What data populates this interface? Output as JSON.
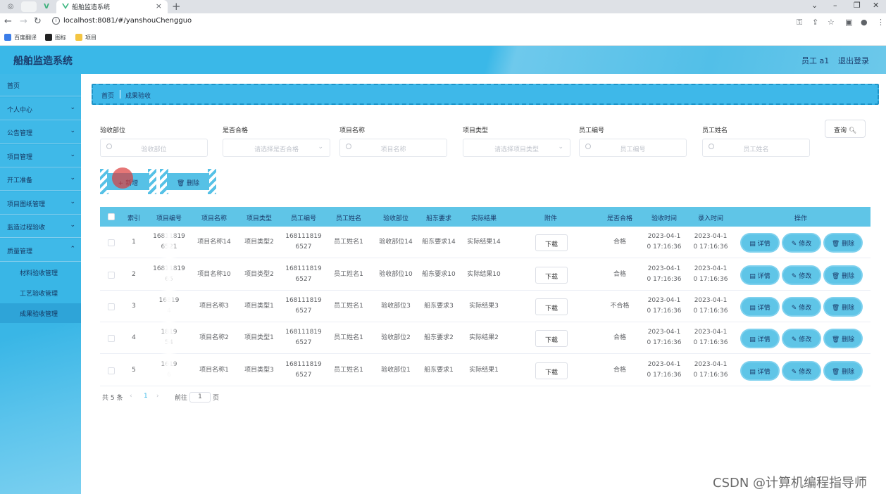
{
  "browser": {
    "tab_title": "船舶监造系统",
    "url": "localhost:8081/#/yanshouChengguo",
    "bookmarks": [
      "百度翻译",
      "图标",
      "项目"
    ]
  },
  "header": {
    "brand": "船舶监造系统",
    "user": "员工 a1",
    "logout": "退出登录"
  },
  "sidebar": {
    "items": [
      {
        "label": "首页",
        "chevron": false
      },
      {
        "label": "个人中心",
        "chevron": true
      },
      {
        "label": "公告管理",
        "chevron": true
      },
      {
        "label": "项目管理",
        "chevron": true
      },
      {
        "label": "开工准备",
        "chevron": true
      },
      {
        "label": "项目图纸管理",
        "chevron": true
      },
      {
        "label": "监造过程验收",
        "chevron": true
      },
      {
        "label": "质量管理",
        "chevron": true,
        "expanded": true
      }
    ],
    "sub_items": [
      "材料验收管理",
      "工艺验收管理",
      "成果验收管理"
    ],
    "active_sub": "成果验收管理"
  },
  "breadcrumb": {
    "home": "首页",
    "current": "成果验收"
  },
  "filters": [
    {
      "label": "验收部位",
      "placeholder": "验收部位",
      "type": "input"
    },
    {
      "label": "是否合格",
      "placeholder": "请选择是否合格",
      "type": "select"
    },
    {
      "label": "项目名称",
      "placeholder": "项目名称",
      "type": "input"
    },
    {
      "label": "项目类型",
      "placeholder": "请选择项目类型",
      "type": "select"
    },
    {
      "label": "员工编号",
      "placeholder": "员工编号",
      "type": "input"
    },
    {
      "label": "员工姓名",
      "placeholder": "员工姓名",
      "type": "input"
    }
  ],
  "query_button": "查询",
  "toolbar": {
    "add": "+ 新增",
    "delete": "删除"
  },
  "table": {
    "columns": [
      "索引",
      "项目编号",
      "项目名称",
      "项目类型",
      "员工编号",
      "员工姓名",
      "验收部位",
      "船东要求",
      "实际结果",
      "附件",
      "是否合格",
      "验收时间",
      "录入时间",
      "操作"
    ],
    "download_label": "下载",
    "actions": [
      "详情",
      "修改",
      "删除"
    ],
    "rows": [
      {
        "index": "1",
        "project_no": [
          "16811819",
          "6521"
        ],
        "project_name": "项目名称14",
        "project_type": "项目类型2",
        "emp_no": [
          "168111819",
          "6527"
        ],
        "emp_name": "员工姓名1",
        "part": "验收部位14",
        "owner_req": "船东要求14",
        "result": "实际结果14",
        "qualified": "合格",
        "check_time": [
          "2023-04-1",
          "0 17:16:36"
        ],
        "entry_time": [
          "2023-04-1",
          "0 17:16:36"
        ]
      },
      {
        "index": "2",
        "project_no": [
          "16811819",
          "65"
        ],
        "project_name": "项目名称10",
        "project_type": "项目类型2",
        "emp_no": [
          "168111819",
          "6527"
        ],
        "emp_name": "员工姓名1",
        "part": "验收部位10",
        "owner_req": "船东要求10",
        "result": "实际结果10",
        "qualified": "合格",
        "check_time": [
          "2023-04-1",
          "0 17:16:36"
        ],
        "entry_time": [
          "2023-04-1",
          "0 17:16:36"
        ]
      },
      {
        "index": "3",
        "project_no": [
          "16819",
          "4"
        ],
        "project_name": "项目名称3",
        "project_type": "项目类型1",
        "emp_no": [
          "168111819",
          "6527"
        ],
        "emp_name": "员工姓名1",
        "part": "验收部位3",
        "owner_req": "船东要求3",
        "result": "实际结果3",
        "qualified": "不合格",
        "check_time": [
          "2023-04-1",
          "0 17:16:36"
        ],
        "entry_time": [
          "2023-04-1",
          "0 17:16:36"
        ]
      },
      {
        "index": "4",
        "project_no": [
          "1819",
          "54"
        ],
        "project_name": "项目名称2",
        "project_type": "项目类型1",
        "emp_no": [
          "168111819",
          "6527"
        ],
        "emp_name": "员工姓名1",
        "part": "验收部位2",
        "owner_req": "船东要求2",
        "result": "实际结果2",
        "qualified": "合格",
        "check_time": [
          "2023-04-1",
          "0 17:16:36"
        ],
        "entry_time": [
          "2023-04-1",
          "0 17:16:36"
        ]
      },
      {
        "index": "5",
        "project_no": [
          "1619",
          "6"
        ],
        "project_name": "项目名称1",
        "project_type": "项目类型3",
        "emp_no": [
          "168111819",
          "6527"
        ],
        "emp_name": "员工姓名1",
        "part": "验收部位1",
        "owner_req": "船东要求1",
        "result": "实际结果1",
        "qualified": "合格",
        "check_time": [
          "2023-04-1",
          "0 17:16:36"
        ],
        "entry_time": [
          "2023-04-1",
          "0 17:16:36"
        ]
      }
    ]
  },
  "pagination": {
    "total": "共 5 条",
    "current": "1",
    "goto": "前往",
    "page_input": "1",
    "page_unit": "页"
  },
  "watermark": "CSDN @计算机编程指导师",
  "colors": {
    "primary": "#3ab8e8",
    "header_text": "#1b3b6b"
  }
}
